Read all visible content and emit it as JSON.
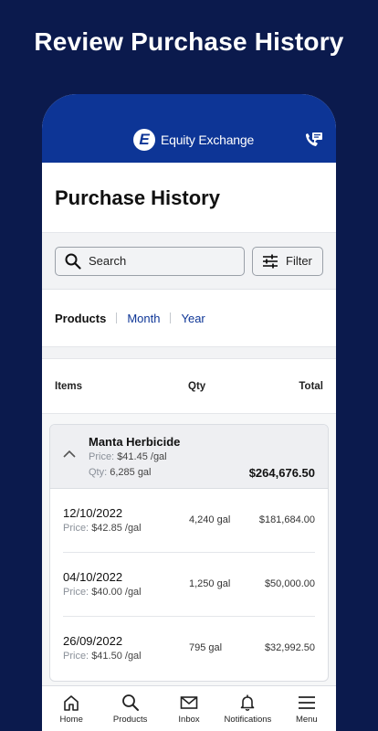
{
  "banner": {
    "title": "Review Purchase History"
  },
  "app": {
    "logo_letter": "E",
    "logo_text": "Equity Exchange"
  },
  "page": {
    "title": "Purchase History"
  },
  "search": {
    "label": "Search"
  },
  "filter": {
    "label": "Filter"
  },
  "tabs": [
    {
      "label": "Products",
      "active": true
    },
    {
      "label": "Month",
      "active": false
    },
    {
      "label": "Year",
      "active": false
    }
  ],
  "columns": {
    "items": "Items",
    "qty": "Qty",
    "total": "Total"
  },
  "product": {
    "name": "Manta Herbicide",
    "price_label": "Price:",
    "price": "$41.45 /gal",
    "qty_label": "Qty:",
    "qty": "6,285 gal",
    "total": "$264,676.50",
    "purchases": [
      {
        "date": "12/10/2022",
        "price_label": "Price:",
        "price": "$42.85 /gal",
        "qty": "4,240 gal",
        "total": "$181,684.00"
      },
      {
        "date": "04/10/2022",
        "price_label": "Price:",
        "price": "$40.00 /gal",
        "qty": "1,250 gal",
        "total": "$50,000.00"
      },
      {
        "date": "26/09/2022",
        "price_label": "Price:",
        "price": "$41.50 /gal",
        "qty": "795 gal",
        "total": "$32,992.50"
      }
    ]
  },
  "nav": [
    {
      "label": "Home",
      "icon": "home-icon"
    },
    {
      "label": "Products",
      "icon": "search-icon"
    },
    {
      "label": "Inbox",
      "icon": "mail-icon"
    },
    {
      "label": "Notifications",
      "icon": "bell-icon"
    },
    {
      "label": "Menu",
      "icon": "menu-icon"
    }
  ],
  "colors": {
    "background": "#0b1a4d",
    "brand": "#0d3596",
    "link": "#0d3596"
  }
}
